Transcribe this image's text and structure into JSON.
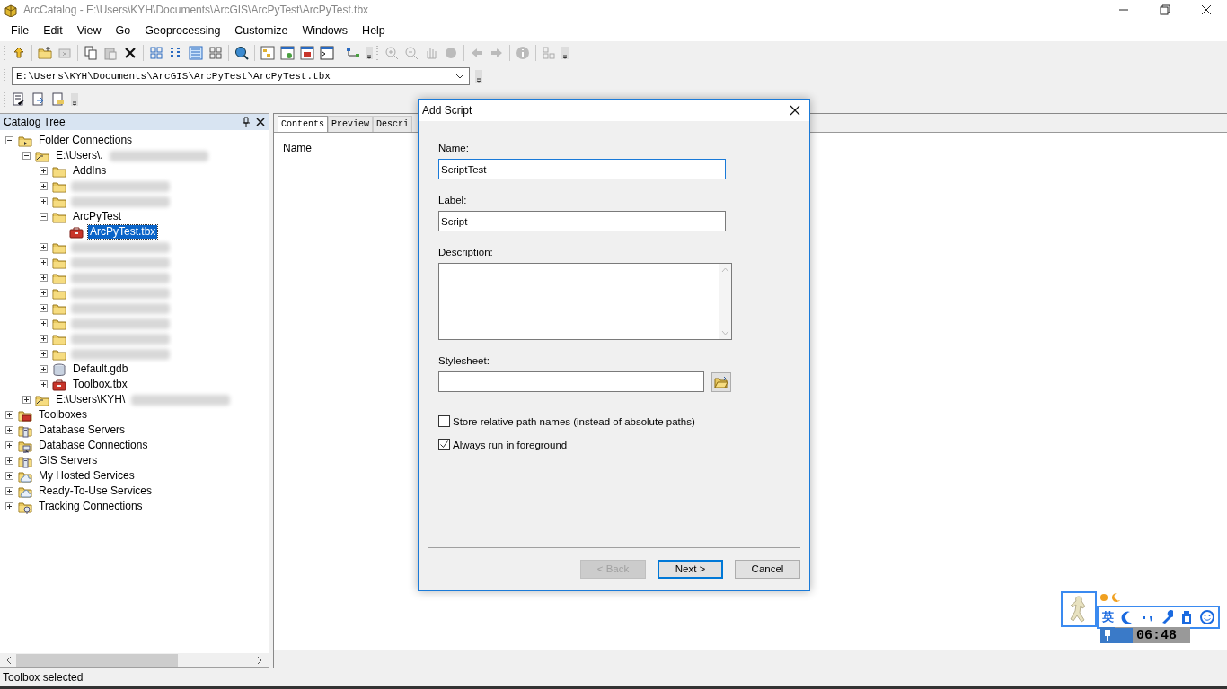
{
  "window": {
    "title": "ArcCatalog - E:\\Users\\KYH\\Documents\\ArcGIS\\ArcPyTest\\ArcPyTest.tbx"
  },
  "menu": [
    "File",
    "Edit",
    "View",
    "Go",
    "Geoprocessing",
    "Customize",
    "Windows",
    "Help"
  ],
  "address": {
    "value": "E:\\Users\\KYH\\Documents\\ArcGIS\\ArcPyTest\\ArcPyTest.tbx"
  },
  "catalog_tree": {
    "title": "Catalog Tree",
    "items": [
      {
        "label": "Folder Connections",
        "kind": "connections",
        "expanded": true,
        "selected": false,
        "children": [
          {
            "label": "E:\\Users\\.",
            "kind": "connection",
            "expanded": true,
            "selected": false,
            "blurred": true,
            "children": [
              {
                "label": "AddIns",
                "kind": "folder",
                "expanded": false,
                "selected": false
              },
              {
                "kind": "folder",
                "expanded": false,
                "selected": false,
                "blurred": true
              },
              {
                "kind": "folder",
                "expanded": false,
                "selected": false,
                "blurred": true
              },
              {
                "label": "ArcPyTest",
                "kind": "folder",
                "expanded": true,
                "selected": false,
                "children": [
                  {
                    "label": "ArcPyTest.tbx",
                    "kind": "toolbox",
                    "selected": true
                  }
                ]
              },
              {
                "kind": "folder",
                "expanded": false,
                "selected": false,
                "blurred": true
              },
              {
                "kind": "folder",
                "expanded": false,
                "selected": false,
                "blurred": true
              },
              {
                "kind": "folder",
                "expanded": false,
                "selected": false,
                "blurred": true
              },
              {
                "kind": "folder",
                "expanded": false,
                "selected": false,
                "blurred": true
              },
              {
                "kind": "folder",
                "expanded": false,
                "selected": false,
                "blurred": true
              },
              {
                "kind": "folder",
                "expanded": false,
                "selected": false,
                "blurred": true
              },
              {
                "kind": "folder",
                "expanded": false,
                "selected": false,
                "blurred": true
              },
              {
                "kind": "folder",
                "expanded": false,
                "selected": false,
                "blurred": true
              },
              {
                "label": "Default.gdb",
                "kind": "gdb",
                "expanded": false,
                "selected": false
              },
              {
                "label": "Toolbox.tbx",
                "kind": "toolbox",
                "expanded": false,
                "selected": false
              }
            ]
          },
          {
            "label": "E:\\Users\\KYH\\",
            "kind": "connection",
            "expanded": false,
            "selected": false,
            "blurred": true
          }
        ]
      },
      {
        "label": "Toolboxes",
        "kind": "toolboxes",
        "expanded": false,
        "selected": false
      },
      {
        "label": "Database Servers",
        "kind": "servers",
        "expanded": false,
        "selected": false
      },
      {
        "label": "Database Connections",
        "kind": "dbconn",
        "expanded": false,
        "selected": false
      },
      {
        "label": "GIS Servers",
        "kind": "servers",
        "expanded": false,
        "selected": false
      },
      {
        "label": "My Hosted Services",
        "kind": "cloud",
        "expanded": false,
        "selected": false
      },
      {
        "label": "Ready-To-Use Services",
        "kind": "cloud",
        "expanded": false,
        "selected": false
      },
      {
        "label": "Tracking Connections",
        "kind": "tracking",
        "expanded": false,
        "selected": false
      }
    ]
  },
  "tabs": [
    {
      "label": "Contents",
      "selected": true
    },
    {
      "label": "Preview",
      "selected": false
    },
    {
      "label": "Descri",
      "selected": false
    }
  ],
  "contents": {
    "columns": [
      "Name"
    ]
  },
  "dialog": {
    "title": "Add Script",
    "fields": [
      {
        "label": "Name:",
        "kind": "text",
        "value": "ScriptTest",
        "focused": true
      },
      {
        "label": "Label:",
        "kind": "text",
        "value": "Script",
        "focused": false
      },
      {
        "label": "Description:",
        "kind": "textarea",
        "focused": false
      },
      {
        "label": "Stylesheet:",
        "kind": "file",
        "focused": false
      }
    ],
    "checkboxes": [
      {
        "label": "Store relative path names (instead of absolute paths)",
        "checked": false
      },
      {
        "label": "Always run in foreground",
        "checked": true
      }
    ],
    "buttons": [
      {
        "label": "< Back",
        "disabled": true,
        "default": false
      },
      {
        "label": "Next >",
        "disabled": false,
        "default": true
      },
      {
        "label": "Cancel",
        "disabled": false,
        "default": false
      }
    ]
  },
  "ime": {
    "mode": "英",
    "time": "06:48"
  },
  "status_bar": "Toolbox selected"
}
